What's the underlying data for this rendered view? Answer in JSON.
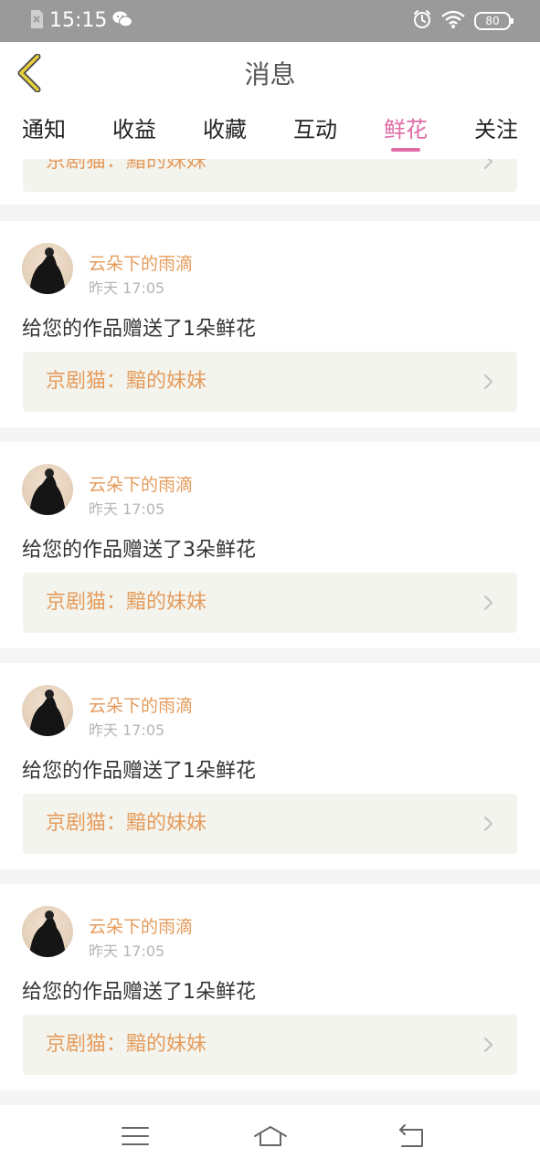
{
  "status_bar": {
    "time": "15:15",
    "battery": "80",
    "icons": [
      "sim-card-icon",
      "wechat-icon",
      "alarm-icon",
      "wifi-icon",
      "battery-icon"
    ]
  },
  "header": {
    "title": "消息"
  },
  "tabs": [
    {
      "label": "通知"
    },
    {
      "label": "收益"
    },
    {
      "label": "收藏"
    },
    {
      "label": "互动"
    },
    {
      "label": "鲜花",
      "active": true
    },
    {
      "label": "关注"
    }
  ],
  "partial_item": {
    "work": "京剧猫：黯的妹妹"
  },
  "messages": [
    {
      "user": "云朵下的雨滴",
      "time": "昨天 17:05",
      "text": "给您的作品赠送了1朵鲜花",
      "work": "京剧猫：黯的妹妹"
    },
    {
      "user": "云朵下的雨滴",
      "time": "昨天 17:05",
      "text": "给您的作品赠送了3朵鲜花",
      "work": "京剧猫：黯的妹妹"
    },
    {
      "user": "云朵下的雨滴",
      "time": "昨天 17:05",
      "text": "给您的作品赠送了1朵鲜花",
      "work": "京剧猫：黯的妹妹"
    },
    {
      "user": "云朵下的雨滴",
      "time": "昨天 17:05",
      "text": "给您的作品赠送了1朵鲜花",
      "work": "京剧猫：黯的妹妹"
    }
  ],
  "colors": {
    "accent_pink": "#e06aa6",
    "orange_text": "#e59c5d",
    "status_bar": "#9a9a9a",
    "back_arrow": "#c9a92a"
  },
  "bottom_nav": [
    "menu-icon",
    "home-icon",
    "back-icon"
  ]
}
